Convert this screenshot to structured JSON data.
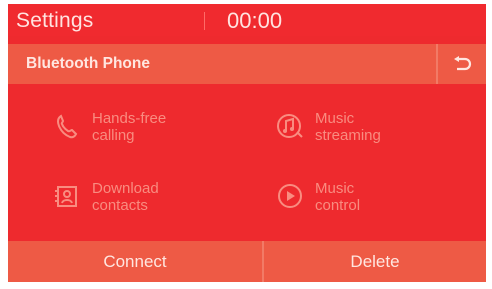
{
  "status": {
    "app_title": "Settings",
    "time": "00:00"
  },
  "header": {
    "title": "Bluetooth Phone",
    "back_icon": "back-arrow-icon"
  },
  "features": [
    {
      "label_line1": "Hands-free",
      "label_line2": "calling",
      "icon": "phone-icon"
    },
    {
      "label_line1": "Music",
      "label_line2": "streaming",
      "icon": "music-streaming-icon"
    },
    {
      "label_line1": "Download",
      "label_line2": "contacts",
      "icon": "contacts-icon"
    },
    {
      "label_line1": "Music",
      "label_line2": "control",
      "icon": "play-icon"
    }
  ],
  "buttons": {
    "connect_label": "Connect",
    "delete_label": "Delete"
  },
  "colors": {
    "background": "#ee2a2e",
    "bar": "#ee5a45",
    "text": "#ffe6e0",
    "disabled_text": "#f98c80"
  }
}
